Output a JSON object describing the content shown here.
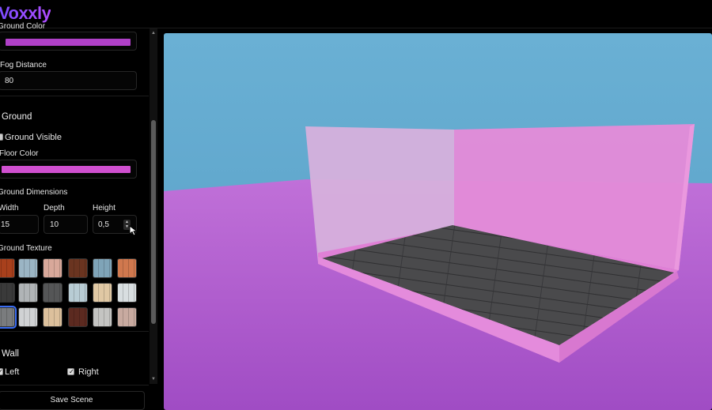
{
  "app": {
    "logo": "Voxxly"
  },
  "sidebar": {
    "ground_color_label": "Ground Color",
    "fog_distance_label": "Fog Distance",
    "fog_distance_value": "80",
    "ground_section_title": "Ground",
    "ground_visible_label": "Ground Visible",
    "floor_color_label": "Floor Color",
    "ground_dimensions_label": "Ground Dimensions",
    "width_label": "Width",
    "width_value": "15",
    "depth_label": "Depth",
    "depth_value": "10",
    "height_label": "Height",
    "height_value": "0,5",
    "ground_texture_label": "Ground Texture",
    "wall_section_title": "Wall",
    "wall_left_label": "Left",
    "wall_right_label": "Right",
    "save_button_label": "Save Scene"
  },
  "colors": {
    "ground_color": "#b040c8",
    "floor_color": "#d050d0",
    "sky": "#6aaed0",
    "ground_plane": "#b048c8"
  },
  "textures": [
    {
      "name": "red-brick",
      "color": "#a8401c"
    },
    {
      "name": "blue-marble",
      "color": "#9bb5c4"
    },
    {
      "name": "pink-stone",
      "color": "#d8a89a"
    },
    {
      "name": "brown-wood",
      "color": "#6a3420"
    },
    {
      "name": "blue-wood",
      "color": "#7fa4b8"
    },
    {
      "name": "orange-brick",
      "color": "#d0784e"
    },
    {
      "name": "dark-planks",
      "color": "#3a3a3a"
    },
    {
      "name": "grey-tiles",
      "color": "#b0b4b6"
    },
    {
      "name": "dark-tiles",
      "color": "#555657"
    },
    {
      "name": "light-marble",
      "color": "#b8ccd4"
    },
    {
      "name": "beige-stone",
      "color": "#e0c8a4"
    },
    {
      "name": "white-planks",
      "color": "#d8dee0"
    },
    {
      "name": "grey-concrete",
      "color": "#7a7c7e"
    },
    {
      "name": "white-grid",
      "color": "#d0d2d4"
    },
    {
      "name": "sand-wood",
      "color": "#dcc09c"
    },
    {
      "name": "mahogany",
      "color": "#5c2a20"
    },
    {
      "name": "light-grey-stone",
      "color": "#c4c4c2"
    },
    {
      "name": "rose-brick",
      "color": "#c8aaa0"
    }
  ]
}
